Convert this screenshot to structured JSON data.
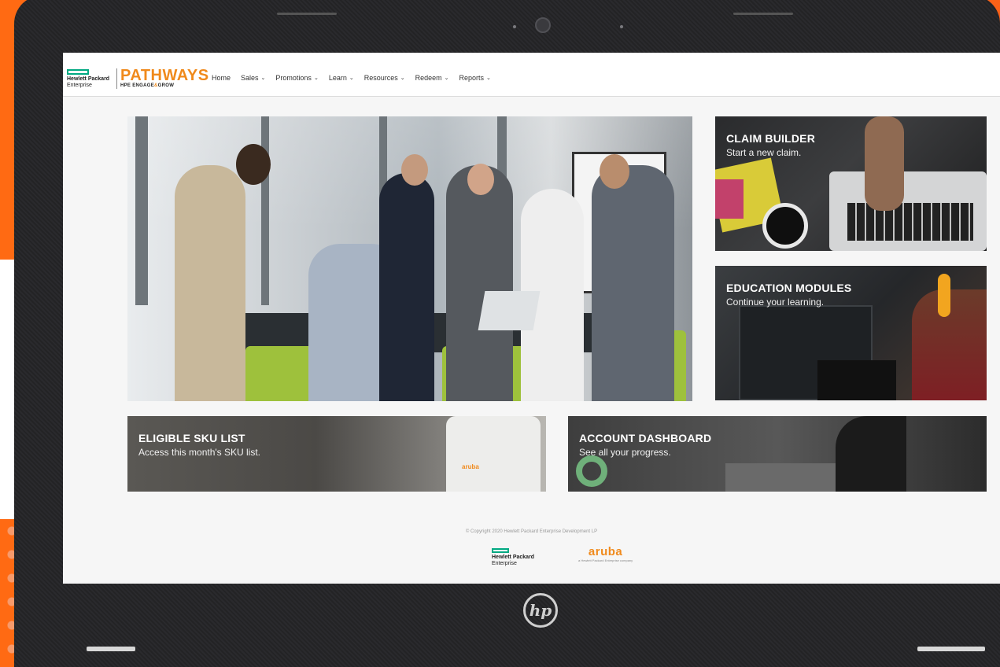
{
  "brand": {
    "company_line1": "Hewlett Packard",
    "company_line2": "Enterprise",
    "program": "PATHWAYS",
    "tagline_pre": "HPE ENGAGE",
    "tagline_amp": "&",
    "tagline_post": "GROW"
  },
  "nav": [
    {
      "label": "Home"
    },
    {
      "label": "Sales",
      "chevron": "⌄"
    },
    {
      "label": "Promotions",
      "chevron": "⌄"
    },
    {
      "label": "Learn",
      "chevron": "⌄"
    },
    {
      "label": "Resources",
      "chevron": "⌄"
    },
    {
      "label": "Redeem",
      "chevron": "⌄"
    },
    {
      "label": "Reports",
      "chevron": "⌄"
    }
  ],
  "tiles": {
    "claim": {
      "title": "CLAIM BUILDER",
      "subtitle": "Start a new claim."
    },
    "education": {
      "title": "EDUCATION MODULES",
      "subtitle": "Continue your learning."
    },
    "sku": {
      "title": "ELIGIBLE SKU LIST",
      "subtitle": "Access this month's SKU list."
    },
    "account": {
      "title": "ACCOUNT DASHBOARD",
      "subtitle": "See all your progress."
    }
  },
  "footer": {
    "copyright": "© Copyright 2020 Hewlett Packard Enterprise Development LP",
    "hpe_line1": "Hewlett Packard",
    "hpe_line2": "Enterprise",
    "aruba": "aruba",
    "aruba_sub": "a Hewlett Packard Enterprise company"
  },
  "laptop_logo": "hp",
  "colors": {
    "accent_orange": "#f08a1c",
    "hpe_green": "#01a982",
    "backdrop": "#ff6a13"
  }
}
